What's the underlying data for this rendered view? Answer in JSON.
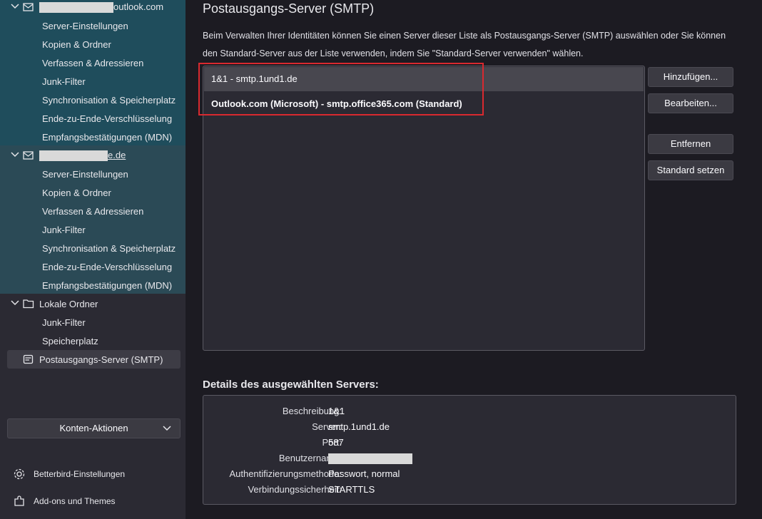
{
  "sidebar": {
    "account1": {
      "name_suffix": "outlook.com",
      "items": [
        "Server-Einstellungen",
        "Kopien & Ordner",
        "Verfassen & Adressieren",
        "Junk-Filter",
        "Synchronisation & Speicherplatz",
        "Ende-zu-Ende-Verschlüsselung",
        "Empfangsbestätigungen (MDN)"
      ]
    },
    "account2": {
      "name_suffix": "e.de",
      "items": [
        "Server-Einstellungen",
        "Kopien & Ordner",
        "Verfassen & Adressieren",
        "Junk-Filter",
        "Synchronisation & Speicherplatz",
        "Ende-zu-Ende-Verschlüsselung",
        "Empfangsbestätigungen (MDN)"
      ]
    },
    "local": {
      "name": "Lokale Ordner",
      "items": [
        "Junk-Filter",
        "Speicherplatz"
      ]
    },
    "smtp_item": "Postausgangs-Server (SMTP)",
    "account_actions": "Konten-Aktionen",
    "footer": {
      "settings": "Betterbird-Einstellungen",
      "addons": "Add-ons und Themes"
    }
  },
  "main": {
    "title": "Postausgangs-Server (SMTP)",
    "intro": "Beim Verwalten Ihrer Identitäten können Sie einen Server dieser Liste als Postausgangs-Server (SMTP) auswählen oder Sie können den Standard-Server aus der Liste verwenden, indem Sie \"Standard-Server verwenden\" wählen.",
    "servers": [
      "1&1 - smtp.1und1.de",
      "Outlook.com (Microsoft) - smtp.office365.com (Standard)"
    ],
    "buttons": {
      "add": "Hinzufügen...",
      "edit": "Bearbeiten...",
      "remove": "Entfernen",
      "set_default": "Standard setzen"
    },
    "details": {
      "heading": "Details des ausgewählten Servers:",
      "description_label": "Beschreibung:",
      "description_value": "1&1",
      "server_label": "Server:",
      "server_value": "smtp.1und1.de",
      "port_label": "Port:",
      "port_value": "587",
      "username_label": "Benutzername:",
      "auth_label": "Authentifizierungsmethode:",
      "auth_value": "Passwort, normal",
      "security_label": "Verbindungssicherheit:",
      "security_value": "STARTTLS"
    }
  },
  "colors": {
    "highlight_border": "#d9292f",
    "account1_bg": "#1f4d5c",
    "account2_bg": "#2b4a56"
  }
}
